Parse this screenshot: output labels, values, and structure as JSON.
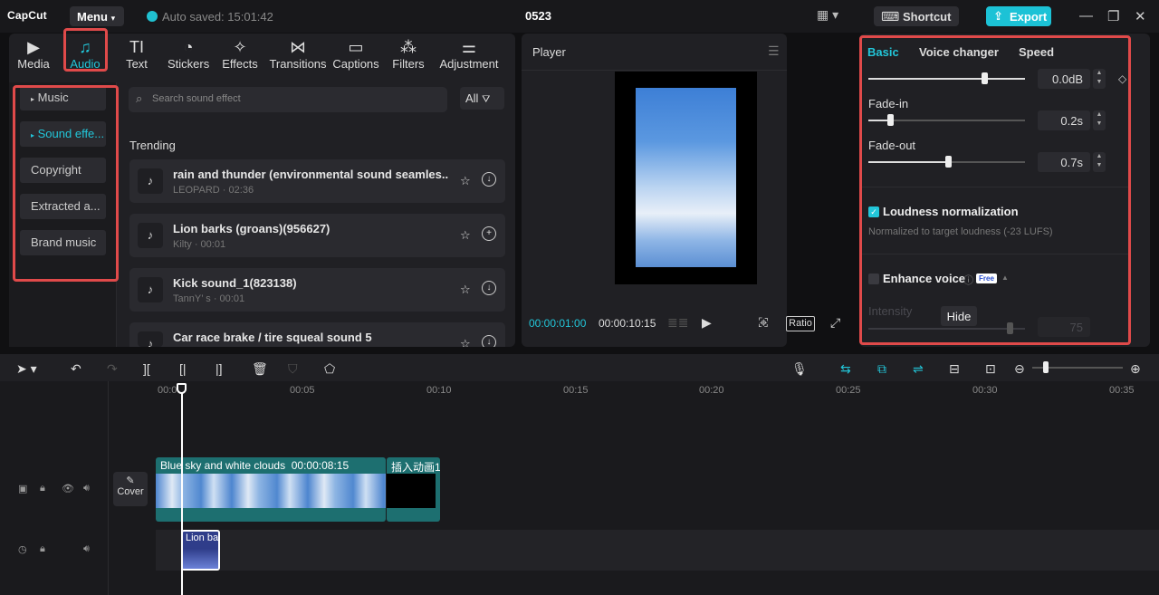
{
  "title_bar": {
    "logo_text": "CapCut",
    "menu_label": "Menu",
    "autosave_text": "Auto saved: 15:01:42",
    "project_name": "0523",
    "shortcut_label": "Shortcut",
    "export_label": "Export"
  },
  "media_toolbar": {
    "tabs": [
      {
        "label": "Media",
        "icon": "media-icon"
      },
      {
        "label": "Audio",
        "icon": "audio-icon",
        "active": true
      },
      {
        "label": "Text",
        "icon": "text-icon"
      },
      {
        "label": "Stickers",
        "icon": "sticker-icon"
      },
      {
        "label": "Effects",
        "icon": "effects-icon"
      },
      {
        "label": "Transitions",
        "icon": "transitions-icon"
      },
      {
        "label": "Captions",
        "icon": "captions-icon"
      },
      {
        "label": "Filters",
        "icon": "filters-icon"
      },
      {
        "label": "Adjustment",
        "icon": "adjustment-icon"
      }
    ]
  },
  "audio_sidebar": {
    "items": [
      {
        "label": "Music"
      },
      {
        "label": "Sound effe...",
        "active": true
      },
      {
        "label": "Copyright"
      },
      {
        "label": "Extracted a..."
      },
      {
        "label": "Brand music"
      }
    ]
  },
  "search": {
    "placeholder": "Search sound effect",
    "filter_label": "All"
  },
  "trending": {
    "heading": "Trending",
    "items": [
      {
        "title": "rain and thunder (environmental sound seamles...",
        "meta": "LEOPARD · 02:36",
        "action": "download"
      },
      {
        "title": "Lion barks (groans)(956627)",
        "meta": "Kilty · 00:01",
        "action": "add"
      },
      {
        "title": "Kick sound_1(823138)",
        "meta": "TannY’ s · 00:01",
        "action": "download"
      },
      {
        "title": "Car race brake / tire squeal sound 5",
        "meta": "",
        "action": "download"
      }
    ]
  },
  "player": {
    "title": "Player",
    "current_time": "00:00:01:00",
    "total_time": "00:00:10:15",
    "ratio_label": "Ratio"
  },
  "properties": {
    "tabs": [
      "Basic",
      "Voice changer",
      "Speed"
    ],
    "active_tab": "Basic",
    "volume": {
      "value": "0.0dB",
      "level": 0.74
    },
    "fade_in": {
      "label": "Fade-in",
      "value": "0.2s",
      "level": 0.14
    },
    "fade_out": {
      "label": "Fade-out",
      "value": "0.7s",
      "level": 0.51
    },
    "loudness": {
      "label": "Loudness normalization",
      "checked": true,
      "hint": "Normalized to target loudness (-23 LUFS)"
    },
    "enhance": {
      "label": "Enhance voice",
      "checked": false,
      "badge": "Free"
    },
    "intensity": {
      "label": "Intensity",
      "value": "75",
      "level": 0.9
    },
    "tooltip": "Hide"
  },
  "timeline": {
    "ruler": [
      "00:00",
      "00:05",
      "00:10",
      "00:15",
      "00:20",
      "00:25",
      "00:30",
      "00:35"
    ],
    "video_clip_name": "Blue sky and white clouds",
    "video_clip_duration": "00:00:08:15",
    "second_clip_name": "插入动画1",
    "audio_clip_name": "Lion ba",
    "cover_label": "Cover"
  },
  "colors": {
    "accent": "#22c6d9",
    "highlight_box": "#e04a4a",
    "panel": "#202024"
  }
}
